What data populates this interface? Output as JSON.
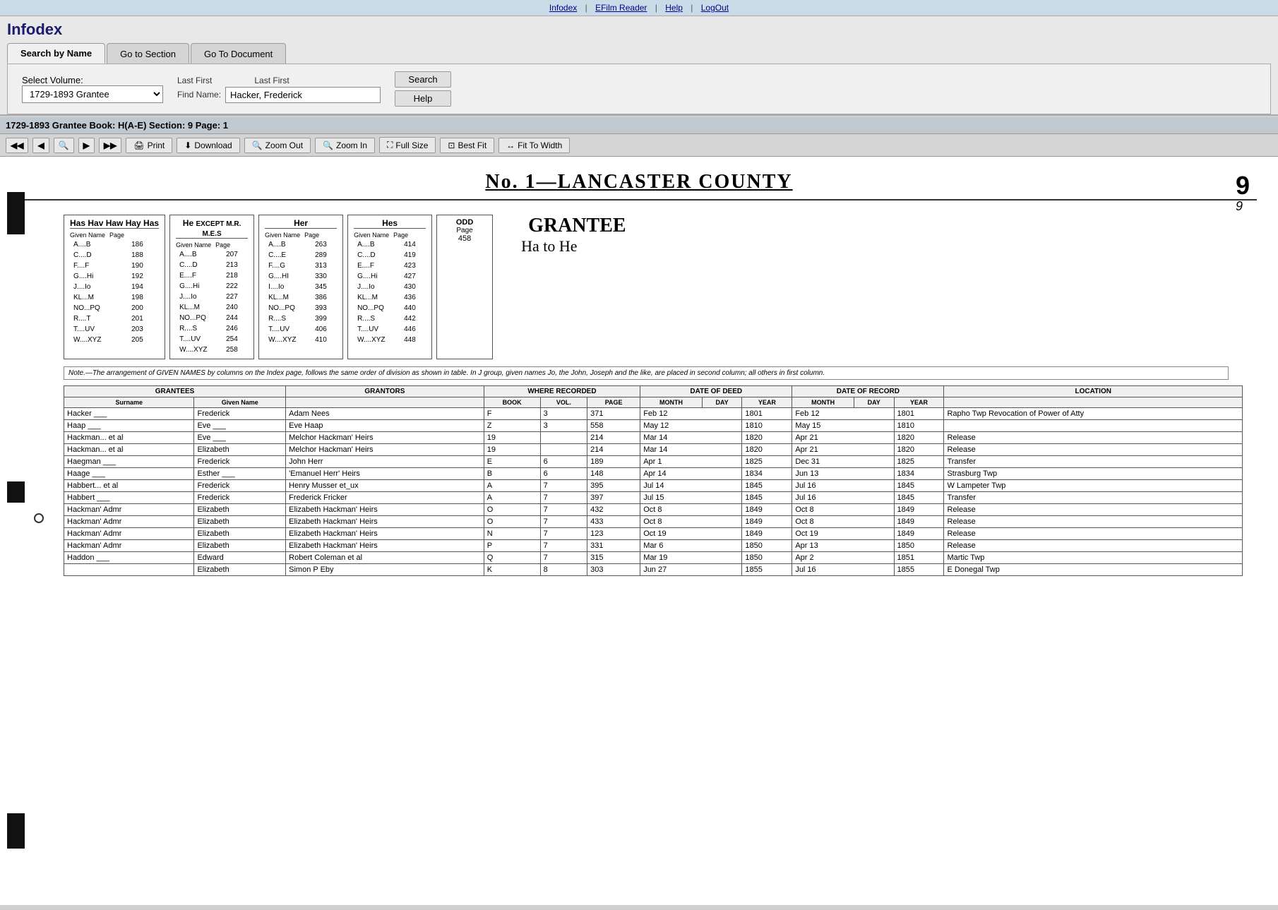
{
  "topnav": {
    "links": [
      "Infodex",
      "EFilm Reader",
      "Help",
      "LogOut"
    ]
  },
  "brand": {
    "title": "Infodex"
  },
  "tabs": [
    {
      "label": "Search by Name",
      "active": true
    },
    {
      "label": "Go to Section",
      "active": false
    },
    {
      "label": "Go To Document",
      "active": false
    }
  ],
  "search": {
    "volume_label": "Select Volume:",
    "volume_value": "1729-1893 Grantee",
    "find_name_label": "Find Name:",
    "find_name_last_first1": "Last First",
    "find_name_last_first2": "Last First",
    "find_name_value": "Hacker, Frederick",
    "search_btn": "Search",
    "help_btn": "Help"
  },
  "bookinfo": {
    "text": "1729-1893 Grantee Book: H(A-E) Section: 9 Page: 1"
  },
  "toolbar": {
    "nav": [
      "◀◀",
      "◀",
      "🔍",
      "▶",
      "▶▶"
    ],
    "print_btn": "Print",
    "download_btn": "Download",
    "zoom_out_btn": "Zoom Out",
    "zoom_in_btn": "Zoom In",
    "full_size_btn": "Full Size",
    "best_fit_btn": "Best Fit",
    "fit_to_width_btn": "Fit To Width"
  },
  "doc": {
    "page_number": "9",
    "page_number_italic": "9",
    "title": "No. 1—LANCASTER COUNTY",
    "index_cols": [
      {
        "header": "Has Hav Haw Hay Has",
        "rows": [
          {
            "name": "A....B",
            "page": "186"
          },
          {
            "name": "C....D",
            "page": "188"
          },
          {
            "name": "F....F",
            "page": "190"
          },
          {
            "name": "G....Hi",
            "page": "192"
          },
          {
            "name": "J....Io",
            "page": "194"
          },
          {
            "name": "KL...M",
            "page": "198"
          },
          {
            "name": "NO...PQ",
            "page": "200"
          },
          {
            "name": "R....T",
            "page": "201"
          },
          {
            "name": "T....UV",
            "page": "203"
          },
          {
            "name": "W....XYZ",
            "page": "205"
          }
        ]
      },
      {
        "header": "He EXCEPT M.R. M.E.S",
        "rows": [
          {
            "name": "A....B",
            "page": "207"
          },
          {
            "name": "C....D",
            "page": "213"
          },
          {
            "name": "E....F",
            "page": "218"
          },
          {
            "name": "G....Hi",
            "page": "222"
          },
          {
            "name": "J....Io",
            "page": "227"
          },
          {
            "name": "KL...M",
            "page": "240"
          },
          {
            "name": "NO...PQ",
            "page": "244"
          },
          {
            "name": "R....S",
            "page": "246"
          },
          {
            "name": "T....UV",
            "page": "254"
          },
          {
            "name": "W....XYZ",
            "page": "258"
          }
        ]
      },
      {
        "header": "Her",
        "rows": [
          {
            "name": "A....B",
            "page": "263"
          },
          {
            "name": "C....E",
            "page": "289"
          },
          {
            "name": "F....G",
            "page": "313"
          },
          {
            "name": "G....HI",
            "page": "330"
          },
          {
            "name": "I....Io",
            "page": "345"
          },
          {
            "name": "KL...M",
            "page": "386"
          },
          {
            "name": "NO...PQ",
            "page": "393"
          },
          {
            "name": "R....S",
            "page": "399"
          },
          {
            "name": "T....UV",
            "page": "406"
          },
          {
            "name": "W....XYZ",
            "page": "410"
          }
        ]
      },
      {
        "header": "Hes",
        "rows": [
          {
            "name": "A....B",
            "page": "414"
          },
          {
            "name": "C....D",
            "page": "419"
          },
          {
            "name": "E....F",
            "page": "423"
          },
          {
            "name": "G....Hi",
            "page": "427"
          },
          {
            "name": "J....Io",
            "page": "430"
          },
          {
            "name": "KL...M",
            "page": "436"
          },
          {
            "name": "NO...PQ",
            "page": "440"
          },
          {
            "name": "R....S",
            "page": "442"
          },
          {
            "name": "T....UV",
            "page": "446"
          },
          {
            "name": "W....XYZ",
            "page": "448"
          }
        ]
      }
    ],
    "odd_box": {
      "label": "ODD",
      "sub": "Page",
      "page": "458"
    },
    "grantee_label": "GRANTEE",
    "grantee_range": "Ha to He",
    "note": "Note.—The arrangement of GIVEN NAMES by columns on the Index page, follows the same order of division as shown in table. In J group, given names Jo, the John, Joseph and the like, are placed in second column; all others in first column.",
    "table_headers": {
      "grantees": "GRANTEES",
      "grantors": "GRANTORS",
      "where_recorded": "WHERE RECORDED",
      "where_sub": [
        "BOOK",
        "VOL.",
        "PAGE"
      ],
      "date_of_deed": "DATE OF DEED",
      "deed_sub": [
        "MONTH",
        "DAY",
        "YEAR"
      ],
      "date_of_record": "DATE OF RECORD",
      "record_sub": [
        "MONTH",
        "DAY",
        "YEAR"
      ],
      "location": "LOCATION"
    },
    "rows": [
      {
        "grantee_last": "Hacker ___",
        "grantee_first": "Frederick",
        "grantor": "Adam Nees",
        "book": "F",
        "vol": "3",
        "page": "371",
        "deed_month": "Feb 12",
        "deed_year": "1801",
        "rec_month": "Feb 12",
        "rec_year": "1801",
        "location": "Rapho Twp Revocation of Power of Atty"
      },
      {
        "grantee_last": "Haap ___",
        "grantee_first": "Eve ___",
        "grantor": "Eve Haap",
        "book": "Z",
        "vol": "3",
        "page": "558",
        "deed_month": "May 12",
        "deed_year": "1810",
        "rec_month": "May 15",
        "rec_year": "1810",
        "location": ""
      },
      {
        "grantee_last": "Hackman... et al",
        "grantee_first": "Eve ___",
        "grantor": "Melchor Hackman' Heirs",
        "book": "19",
        "vol": "",
        "page": "214",
        "deed_month": "Mar 14",
        "deed_year": "1820",
        "rec_month": "Apr 21",
        "rec_year": "1820",
        "location": "Release"
      },
      {
        "grantee_last": "Hackman... et al",
        "grantee_first": "Elizabeth",
        "grantor": "Melchor Hackman' Heirs",
        "book": "19",
        "vol": "",
        "page": "214",
        "deed_month": "Mar 14",
        "deed_year": "1820",
        "rec_month": "Apr 21",
        "rec_year": "1820",
        "location": "Release"
      },
      {
        "grantee_last": "Haegman ___",
        "grantee_first": "Frederick",
        "grantor": "John Herr",
        "book": "E",
        "vol": "6",
        "page": "189",
        "deed_month": "Apr 1",
        "deed_year": "1825",
        "rec_month": "Dec 31",
        "rec_year": "1825",
        "location": "Transfer"
      },
      {
        "grantee_last": "Haage ___",
        "grantee_first": "Esther ___",
        "grantor": "'Emanuel Herr' Heirs",
        "book": "B",
        "vol": "6",
        "page": "148",
        "deed_month": "Apr 14",
        "deed_year": "1834",
        "rec_month": "Jun 13",
        "rec_year": "1834",
        "location": "Strasburg Twp"
      },
      {
        "grantee_last": "Habbert... et al",
        "grantee_first": "Frederick",
        "grantor": "Henry Musser et_ux",
        "book": "A",
        "vol": "7",
        "page": "395",
        "deed_month": "Jul 14",
        "deed_year": "1845",
        "rec_month": "Jul 16",
        "rec_year": "1845",
        "location": "W Lampeter Twp"
      },
      {
        "grantee_last": "Habbert ___",
        "grantee_first": "Frederick",
        "grantor": "Frederick Fricker",
        "book": "A",
        "vol": "7",
        "page": "397",
        "deed_month": "Jul 15",
        "deed_year": "1845",
        "rec_month": "Jul 16",
        "rec_year": "1845",
        "location": "Transfer"
      },
      {
        "grantee_last": "Hackman' Admr",
        "grantee_first": "Elizabeth",
        "grantor": "Elizabeth Hackman' Heirs",
        "book": "O",
        "vol": "7",
        "page": "432",
        "deed_month": "Oct 8",
        "deed_year": "1849",
        "rec_month": "Oct 8",
        "rec_year": "1849",
        "location": "Release"
      },
      {
        "grantee_last": "Hackman' Admr",
        "grantee_first": "Elizabeth",
        "grantor": "Elizabeth Hackman' Heirs",
        "book": "O",
        "vol": "7",
        "page": "433",
        "deed_month": "Oct 8",
        "deed_year": "1849",
        "rec_month": "Oct 8",
        "rec_year": "1849",
        "location": "Release"
      },
      {
        "grantee_last": "Hackman' Admr",
        "grantee_first": "Elizabeth",
        "grantor": "Elizabeth Hackman' Heirs",
        "book": "N",
        "vol": "7",
        "page": "123",
        "deed_month": "Oct 19",
        "deed_year": "1849",
        "rec_month": "Oct 19",
        "rec_year": "1849",
        "location": "Release"
      },
      {
        "grantee_last": "Hackman' Admr",
        "grantee_first": "Elizabeth",
        "grantor": "Elizabeth Hackman' Heirs",
        "book": "P",
        "vol": "7",
        "page": "331",
        "deed_month": "Mar 6",
        "deed_year": "1850",
        "rec_month": "Apr 13",
        "rec_year": "1850",
        "location": "Release"
      },
      {
        "grantee_last": "Haddon ___",
        "grantee_first": "Edward",
        "grantor": "Robert Coleman et al",
        "book": "Q",
        "vol": "7",
        "page": "315",
        "deed_month": "Mar 19",
        "deed_year": "1850",
        "rec_month": "Apr 2",
        "rec_year": "1851",
        "location": "Martic Twp"
      },
      {
        "grantee_last": "",
        "grantee_first": "Elizabeth",
        "grantor": "Simon P Eby",
        "book": "K",
        "vol": "8",
        "page": "303",
        "deed_month": "Jun 27",
        "deed_year": "1855",
        "rec_month": "Jul 16",
        "rec_year": "1855",
        "location": "E Donegal Twp"
      }
    ]
  }
}
